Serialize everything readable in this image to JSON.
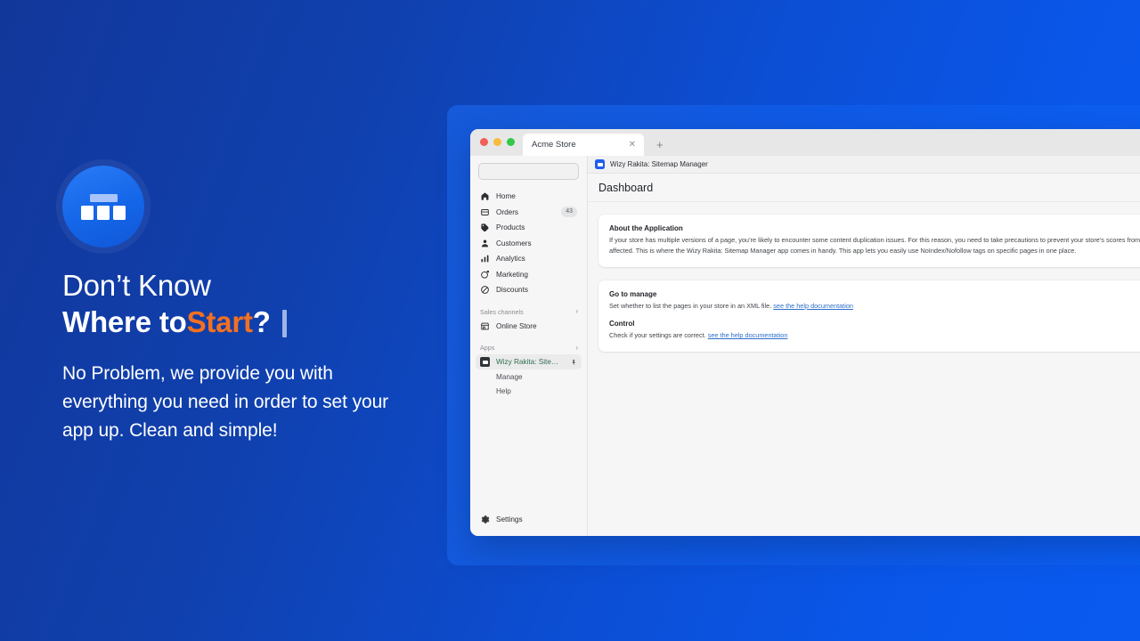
{
  "promo": {
    "logo_icon": "sitemap-logo-icon",
    "headline_line1": "Don’t Know",
    "headline_bold": "Where to ",
    "headline_accent": "Start",
    "headline_question": "?",
    "subcopy": "No Problem, we provide you with everything you need in order to set your app up. Clean and simple!",
    "accent_color": "#f37021",
    "text_color": "#ffffff",
    "background_from": "#12379b",
    "background_to": "#0a5af0"
  },
  "browser": {
    "tab_title": "Acme Store",
    "close_glyph": "✕",
    "newtab_glyph": "+"
  },
  "sidebar": {
    "search_placeholder": "",
    "search_value": "",
    "primary": [
      {
        "label": "Home",
        "icon": "home-icon",
        "badge": ""
      },
      {
        "label": "Orders",
        "icon": "orders-icon",
        "badge": "43"
      },
      {
        "label": "Products",
        "icon": "products-icon",
        "badge": ""
      },
      {
        "label": "Customers",
        "icon": "customers-icon",
        "badge": ""
      },
      {
        "label": "Analytics",
        "icon": "analytics-icon",
        "badge": ""
      },
      {
        "label": "Marketing",
        "icon": "marketing-icon",
        "badge": ""
      },
      {
        "label": "Discounts",
        "icon": "discounts-icon",
        "badge": ""
      }
    ],
    "sections": [
      {
        "label": "Sales channels",
        "chevron": "›"
      },
      {
        "label": "Apps",
        "chevron": "›"
      }
    ],
    "online_store": {
      "label": "Online Store",
      "icon": "store-icon"
    },
    "app_item": {
      "label": "Wizy Rakita: Sitemap ...",
      "icon": "app-tile-icon",
      "pin_icon": "pin-icon"
    },
    "app_subitems": [
      {
        "label": "Manage"
      },
      {
        "label": "Help"
      }
    ],
    "settings": {
      "label": "Settings",
      "icon": "gear-icon"
    }
  },
  "app": {
    "topbar_title": "Wizy Rakita: Sitemap Manager",
    "topbar_icon": "app-square-icon",
    "pin_icon": "pin-icon",
    "page_title": "Dashboard",
    "cards": [
      {
        "title": "About the Application",
        "body": "If your store has multiple versions of a page, you’re likely to encounter some content duplication issues. For this reason, you need to take precautions to prevent your store’s scores from being affected. This is where the Wizy Rakita: Sitemap Manager app comes in handy. This app lets you easily use NoIndex/Nofollow tags on specific pages in one place."
      }
    ],
    "manage_card": {
      "title": "Go to manage",
      "body": "Set whether to list the pages in your store in an XML file.",
      "link": "see the help documentation",
      "sub_title": "Control",
      "sub_body": "Check if your settings are correct.",
      "sub_link": "see the help documentation",
      "link_color": "#2c6ecb"
    }
  }
}
